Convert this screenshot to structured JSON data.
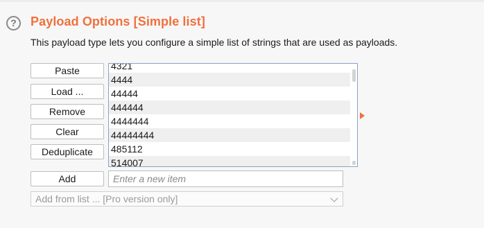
{
  "section": {
    "title": "Payload Options [Simple list]",
    "description": "This payload type lets you configure a simple list of strings that are used as payloads.",
    "help_icon": "?"
  },
  "buttons": {
    "paste": "Paste",
    "load": "Load ...",
    "remove": "Remove",
    "clear": "Clear",
    "deduplicate": "Deduplicate",
    "add": "Add"
  },
  "payload_list": {
    "items": [
      "4321",
      "4444",
      "44444",
      "444444",
      "4444444",
      "44444444",
      "485112",
      "514007"
    ]
  },
  "add_field": {
    "placeholder": "Enter a new item",
    "value": ""
  },
  "add_from_list": {
    "selected": "Add from list ... [Pro version only]"
  },
  "colors": {
    "accent": "#f0703c",
    "list_border": "#8aa2c8"
  }
}
